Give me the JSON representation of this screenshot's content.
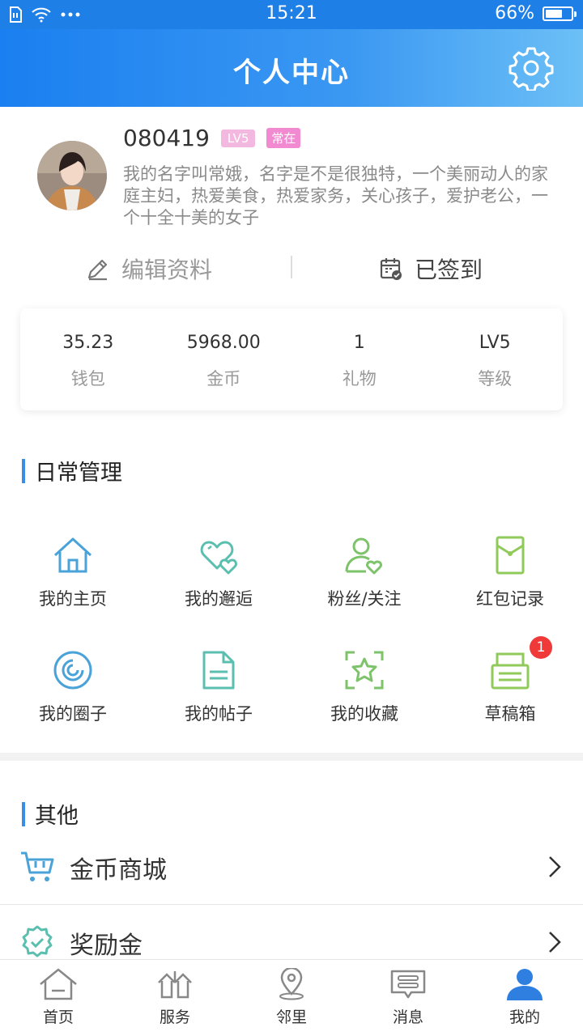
{
  "status_bar": {
    "time": "15:21",
    "battery_text": "66%",
    "battery_level": 0.66
  },
  "header": {
    "title": "个人中心",
    "settings_icon": "gear-icon"
  },
  "profile": {
    "username": "080419",
    "level_badge": "LV5",
    "status_badge": "常在",
    "bio": "我的名字叫常娥，名字是不是很独特，一个美丽动人的家庭主妇，热爱美食，热爱家务，关心孩子，爱护老公，一个十全十美的女子",
    "edit_label": "编辑资料",
    "signed_label": "已签到"
  },
  "stats": [
    {
      "value": "35.23",
      "label": "钱包"
    },
    {
      "value": "5968.00",
      "label": "金币"
    },
    {
      "value": "1",
      "label": "礼物"
    },
    {
      "value": "LV5",
      "label": "等级"
    }
  ],
  "daily": {
    "title": "日常管理",
    "items": [
      {
        "label": "我的主页",
        "icon": "home-icon",
        "color": "#4aa3d8"
      },
      {
        "label": "我的邂逅",
        "icon": "hearts-icon",
        "color": "#5bbfb0"
      },
      {
        "label": "粉丝/关注",
        "icon": "user-heart-icon",
        "color": "#7cc36a"
      },
      {
        "label": "红包记录",
        "icon": "red-packet-icon",
        "color": "#8fca5a"
      },
      {
        "label": "我的圈子",
        "icon": "circle-icon",
        "color": "#4aa3d8"
      },
      {
        "label": "我的帖子",
        "icon": "document-icon",
        "color": "#5bbfb0"
      },
      {
        "label": "我的收藏",
        "icon": "star-icon",
        "color": "#7cc36a"
      },
      {
        "label": "草稿箱",
        "icon": "drafts-icon",
        "color": "#8fca5a",
        "badge": "1"
      }
    ]
  },
  "others": {
    "title": "其他",
    "items": [
      {
        "label": "金币商城",
        "icon": "cart-icon"
      },
      {
        "label": "奖励金",
        "icon": "award-icon"
      }
    ]
  },
  "bottom_nav": [
    {
      "label": "首页",
      "icon": "home-icon"
    },
    {
      "label": "服务",
      "icon": "services-icon"
    },
    {
      "label": "邻里",
      "icon": "location-icon"
    },
    {
      "label": "消息",
      "icon": "message-icon"
    },
    {
      "label": "我的",
      "icon": "person-icon",
      "active": true
    }
  ],
  "colors": {
    "primary": "#1e7fe6",
    "accent_blue": "#3a8ee6",
    "nav_active": "#2f7fe0"
  }
}
